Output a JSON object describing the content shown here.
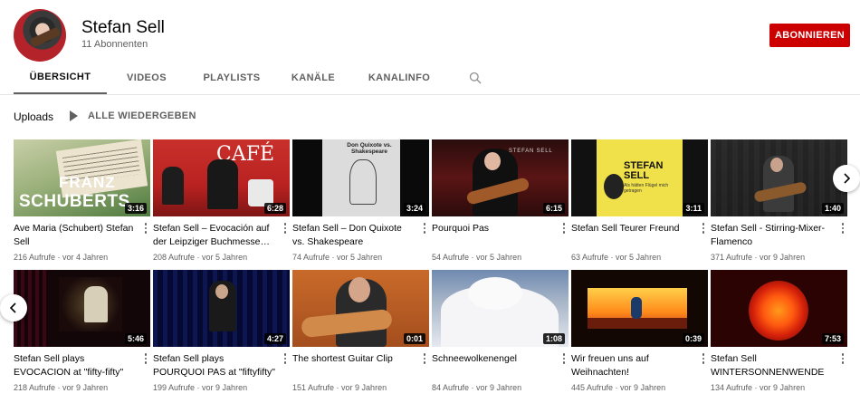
{
  "channel": {
    "name": "Stefan Sell",
    "subscribers": "11 Abonnenten",
    "subscribe_label": "ABONNIEREN"
  },
  "tabs": [
    {
      "label": "ÜBERSICHT",
      "active": true
    },
    {
      "label": "VIDEOS",
      "active": false
    },
    {
      "label": "PLAYLISTS",
      "active": false
    },
    {
      "label": "KANÄLE",
      "active": false
    },
    {
      "label": "KANALINFO",
      "active": false
    }
  ],
  "shelf": {
    "title": "Uploads",
    "play_all_label": "ALLE WIEDERGEBEN"
  },
  "videos": [
    {
      "title": "Ave Maria (Schubert) Stefan Sell",
      "views": "216 Aufrufe",
      "age": "vor 4 Jahren",
      "duration": "3:16",
      "thumb_text": [
        "FRANZ",
        "SCHUBERTS"
      ]
    },
    {
      "title": "Stefan Sell – Evocación auf der Leipziger Buchmesse…",
      "views": "208 Aufrufe",
      "age": "vor 5 Jahren",
      "duration": "6:28",
      "thumb_text": [
        "CAFÉ"
      ]
    },
    {
      "title": "Stefan Sell – Don Quixote vs. Shakespeare",
      "views": "74 Aufrufe",
      "age": "vor 5 Jahren",
      "duration": "3:24",
      "thumb_text": [
        "Don Quixote vs. Shakespeare"
      ]
    },
    {
      "title": "Pourquoi Pas",
      "views": "54 Aufrufe",
      "age": "vor 5 Jahren",
      "duration": "6:15",
      "thumb_text": [
        "STEFAN SELL"
      ]
    },
    {
      "title": "Stefan Sell Teurer Freund",
      "views": "63 Aufrufe",
      "age": "vor 5 Jahren",
      "duration": "3:11",
      "thumb_text": [
        "STEFAN SELL",
        "Als hätten Flügel mich getragen"
      ]
    },
    {
      "title": "Stefan Sell - Stirring-Mixer-Flamenco",
      "views": "371 Aufrufe",
      "age": "vor 9 Jahren",
      "duration": "1:40",
      "thumb_text": []
    },
    {
      "title": "Stefan Sell plays EVOCACION at \"fifty-fifty\" Erlangen",
      "views": "218 Aufrufe",
      "age": "vor 9 Jahren",
      "duration": "5:46",
      "thumb_text": []
    },
    {
      "title": "Stefan Sell plays POURQUOI PAS at \"fiftyfifty\" Erlangen",
      "views": "199 Aufrufe",
      "age": "vor 9 Jahren",
      "duration": "4:27",
      "thumb_text": []
    },
    {
      "title": "The shortest Guitar Clip",
      "views": "151 Aufrufe",
      "age": "vor 9 Jahren",
      "duration": "0:01",
      "thumb_text": []
    },
    {
      "title": "Schneewolkenengel",
      "views": "84 Aufrufe",
      "age": "vor 9 Jahren",
      "duration": "1:08",
      "thumb_text": []
    },
    {
      "title": "Wir freuen uns auf Weihnachten!",
      "views": "445 Aufrufe",
      "age": "vor 9 Jahren",
      "duration": "0:39",
      "thumb_text": []
    },
    {
      "title": "Stefan Sell WINTERSONNENWENDE",
      "views": "134 Aufrufe",
      "age": "vor 9 Jahren",
      "duration": "7:53",
      "thumb_text": []
    }
  ],
  "icons": {
    "search": "search-icon",
    "play": "play-icon",
    "more": "more-vert-icon",
    "next": "chevron-right-icon",
    "prev": "chevron-left-icon"
  },
  "colors": {
    "accent": "#cc0000",
    "text_primary": "#030303",
    "text_secondary": "#606060"
  }
}
